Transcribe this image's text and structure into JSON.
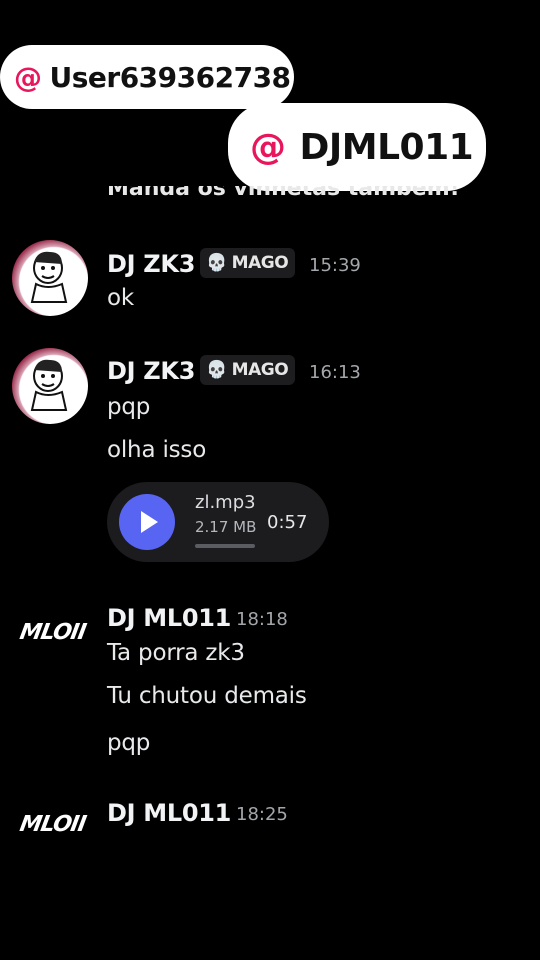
{
  "overlay": {
    "tag1": {
      "at": "@",
      "user": "User639362738"
    },
    "tag2": {
      "at": "@",
      "user": "DJML011"
    }
  },
  "partial_message": "Manda os vinhetas também!",
  "messages": [
    {
      "author": "DJ ZK3",
      "badge": "MAGO",
      "badge_icon": "skull-icon",
      "time": "15:39",
      "lines": [
        "ok"
      ]
    },
    {
      "author": "DJ ZK3",
      "badge": "MAGO",
      "badge_icon": "skull-icon",
      "time": "16:13",
      "lines": [
        "pqp",
        "olha isso"
      ],
      "attachment": {
        "file": "zl.mp3",
        "size": "2.17 MB",
        "duration": "0:57",
        "progress": 0
      }
    },
    {
      "author": "DJ ML011",
      "time": "18:18",
      "lines": [
        "Ta porra zk3",
        "Tu chutou demais",
        "pqp"
      ],
      "avatar_text": "MLOII"
    },
    {
      "author": "DJ ML011",
      "time": "18:25",
      "avatar_text": "MLOII"
    }
  ],
  "colors": {
    "accent": "#5865f2",
    "tag_at": "#e8175d",
    "background": "#000000"
  }
}
